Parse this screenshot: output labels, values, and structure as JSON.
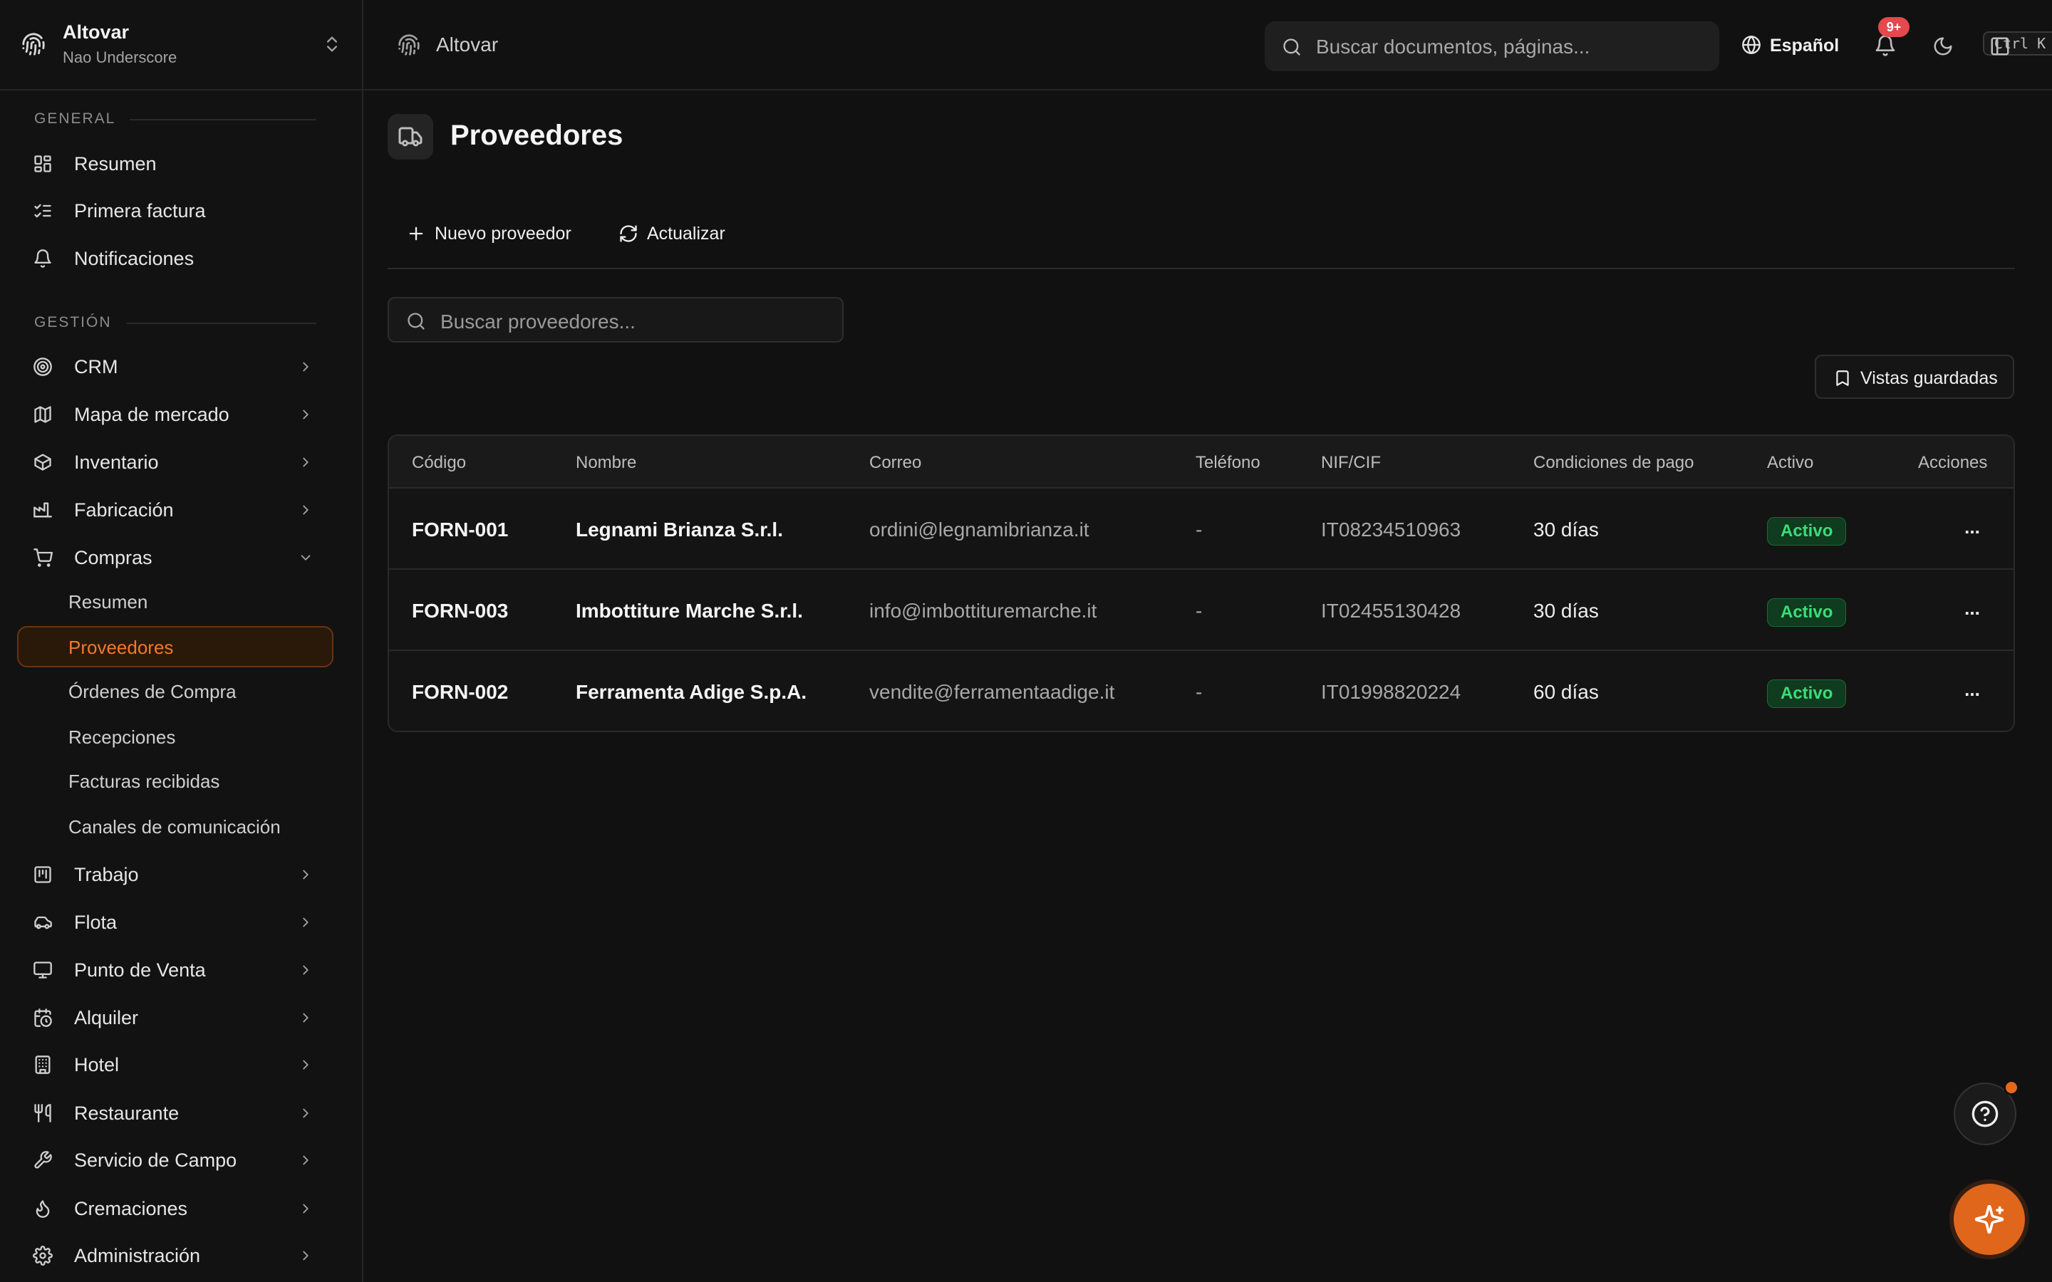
{
  "workspace": {
    "name": "Altovar",
    "user": "Nao Underscore"
  },
  "sidebar": {
    "sections": [
      {
        "label": "GENERAL"
      },
      {
        "label": "GESTIÓN"
      }
    ],
    "general_items": [
      {
        "label": "Resumen",
        "icon": "dashboard-icon"
      },
      {
        "label": "Primera factura",
        "icon": "list-checks-icon"
      },
      {
        "label": "Notificaciones",
        "icon": "bell-icon"
      }
    ],
    "gestion_items": [
      {
        "label": "CRM",
        "icon": "target-icon"
      },
      {
        "label": "Mapa de mercado",
        "icon": "map-icon"
      },
      {
        "label": "Inventario",
        "icon": "package-icon"
      },
      {
        "label": "Fabricación",
        "icon": "factory-icon"
      },
      {
        "label": "Compras",
        "icon": "cart-icon",
        "expanded": true
      },
      {
        "label": "Trabajo",
        "icon": "kanban-icon"
      },
      {
        "label": "Flota",
        "icon": "car-icon"
      },
      {
        "label": "Punto de Venta",
        "icon": "monitor-icon"
      },
      {
        "label": "Alquiler",
        "icon": "calendar-clock-icon"
      },
      {
        "label": "Hotel",
        "icon": "building-icon"
      },
      {
        "label": "Restaurante",
        "icon": "utensils-icon"
      },
      {
        "label": "Servicio de Campo",
        "icon": "wrench-icon"
      },
      {
        "label": "Cremaciones",
        "icon": "flame-icon"
      },
      {
        "label": "Administración",
        "icon": "gear-icon"
      }
    ],
    "compras_sub": [
      {
        "label": "Resumen"
      },
      {
        "label": "Proveedores",
        "active": true
      },
      {
        "label": "Órdenes de Compra"
      },
      {
        "label": "Recepciones"
      },
      {
        "label": "Facturas recibidas"
      },
      {
        "label": "Canales de comunicación"
      }
    ]
  },
  "topbar": {
    "breadcrumb": "Altovar",
    "search_placeholder": "Buscar documentos, páginas...",
    "shortcut": "Ctrl K",
    "language": "Español",
    "notifications_badge": "9+"
  },
  "page": {
    "title": "Proveedores",
    "toolbar": {
      "new_label": "Nuevo proveedor",
      "refresh_label": "Actualizar"
    },
    "search_placeholder": "Buscar proveedores...",
    "saved_views_label": "Vistas guardadas"
  },
  "table": {
    "headers": [
      "Código",
      "Nombre",
      "Correo",
      "Teléfono",
      "NIF/CIF",
      "Condiciones de pago",
      "Activo",
      "Acciones"
    ],
    "rows": [
      {
        "code": "FORN-001",
        "name": "Legnami Brianza S.r.l.",
        "email": "ordini@legnamibrianza.it",
        "phone": "-",
        "nif": "IT08234510963",
        "terms": "30 días",
        "active": "Activo",
        "actions": "..."
      },
      {
        "code": "FORN-003",
        "name": "Imbottiture Marche S.r.l.",
        "email": "info@imbottituremarche.it",
        "phone": "-",
        "nif": "IT02455130428",
        "terms": "30 días",
        "active": "Activo",
        "actions": "..."
      },
      {
        "code": "FORN-002",
        "name": "Ferramenta Adige S.p.A.",
        "email": "vendite@ferramentaadige.it",
        "phone": "-",
        "nif": "IT01998820224",
        "terms": "60 días",
        "active": "Activo",
        "actions": "..."
      }
    ]
  },
  "colors": {
    "accent": "#e0661c",
    "active_nav_bg": "#2a1809",
    "status_active": "#3ddc78",
    "badge_red": "#e5484d",
    "background": "#111111"
  }
}
